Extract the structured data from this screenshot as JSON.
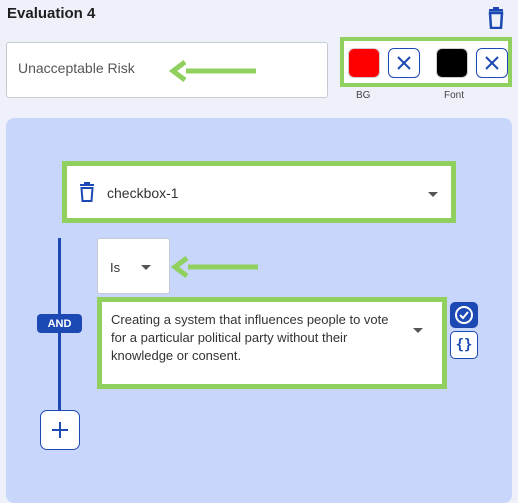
{
  "evaluation": {
    "title": "Evaluation 4",
    "label_value": "Unacceptable Risk"
  },
  "colors": {
    "bg_label": "BG",
    "font_label": "Font",
    "bg_value": "#ff0000",
    "font_value": "#000000",
    "highlight": "#8fd05e",
    "accent": "#1d49b5"
  },
  "condition": {
    "field": "checkbox-1",
    "operator": "Is",
    "logic": "AND",
    "value": "Creating a system that influences people to vote for a particular political party without their knowledge or consent."
  },
  "icons": {
    "delete": "trash-icon",
    "clear": "close-icon",
    "add": "plus-icon",
    "confirm": "check-circle-icon",
    "code": "curly-braces-icon",
    "dropdown": "caret-down-icon",
    "annotation": "arrow-left-icon"
  }
}
